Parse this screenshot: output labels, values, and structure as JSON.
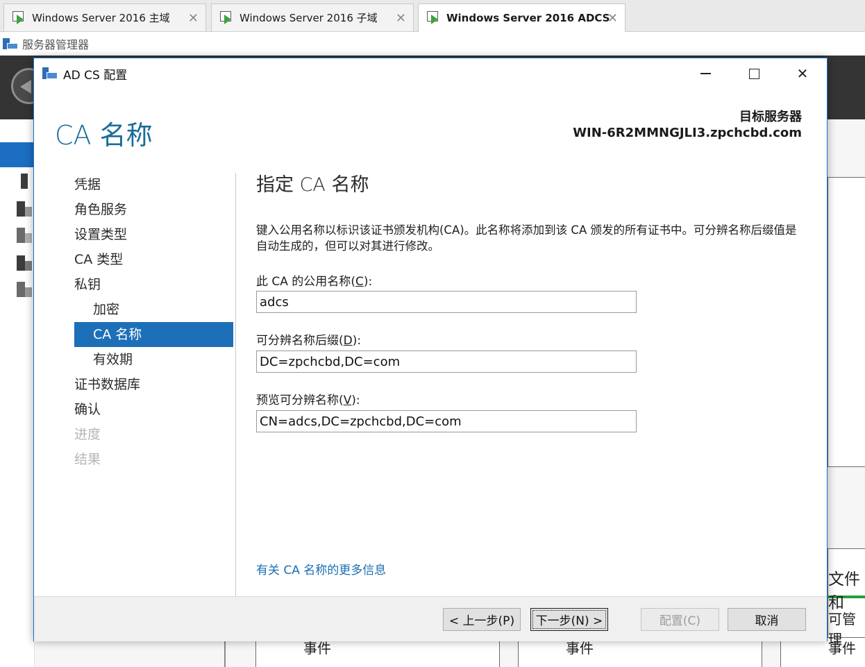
{
  "vm_tabs": [
    {
      "label": "Windows Server 2016 主域",
      "close": "✕"
    },
    {
      "label": "Windows Server 2016 子域",
      "close": "✕"
    },
    {
      "label": "Windows Server 2016 ADCS",
      "close": "✕"
    }
  ],
  "app": {
    "title": "服务器管理器"
  },
  "background": {
    "texts": [
      "文件和",
      "可管理",
      "事件",
      "事件",
      "事件"
    ]
  },
  "dialog": {
    "title": "AD CS 配置",
    "heading": "CA 名称",
    "destination_label": "目标服务器",
    "destination_value": "WIN-6R2MMNGJLI3.zpchcbd.com",
    "steps": [
      {
        "label": "凭据",
        "state": "normal"
      },
      {
        "label": "角色服务",
        "state": "normal"
      },
      {
        "label": "设置类型",
        "state": "normal"
      },
      {
        "label": "CA 类型",
        "state": "normal"
      },
      {
        "label": "私钥",
        "state": "normal"
      },
      {
        "label": "加密",
        "state": "sub"
      },
      {
        "label": "CA 名称",
        "state": "sub-active"
      },
      {
        "label": "有效期",
        "state": "sub"
      },
      {
        "label": "证书数据库",
        "state": "normal"
      },
      {
        "label": "确认",
        "state": "normal"
      },
      {
        "label": "进度",
        "state": "disabled"
      },
      {
        "label": "结果",
        "state": "disabled"
      }
    ],
    "section_title": "指定 CA 名称",
    "description": "键入公用名称以标识该证书颁发机构(CA)。此名称将添加到该 CA 颁发的所有证书中。可分辨名称后缀值是自动生成的，但可以对其进行修改。",
    "fields": {
      "common_name": {
        "label": "此 CA 的公用名称",
        "accesskey": "C",
        "value": "adcs"
      },
      "dn_suffix": {
        "label": "可分辨名称后缀",
        "accesskey": "D",
        "value": "DC=zpchcbd,DC=com"
      },
      "preview_dn": {
        "label": "预览可分辨名称",
        "accesskey": "V",
        "value": "CN=adcs,DC=zpchcbd,DC=com"
      }
    },
    "more_info_link": "有关 CA 名称的更多信息",
    "buttons": {
      "prev": "< 上一步(P)",
      "next": "下一步(N) >",
      "configure": "配置(C)",
      "cancel": "取消"
    }
  }
}
